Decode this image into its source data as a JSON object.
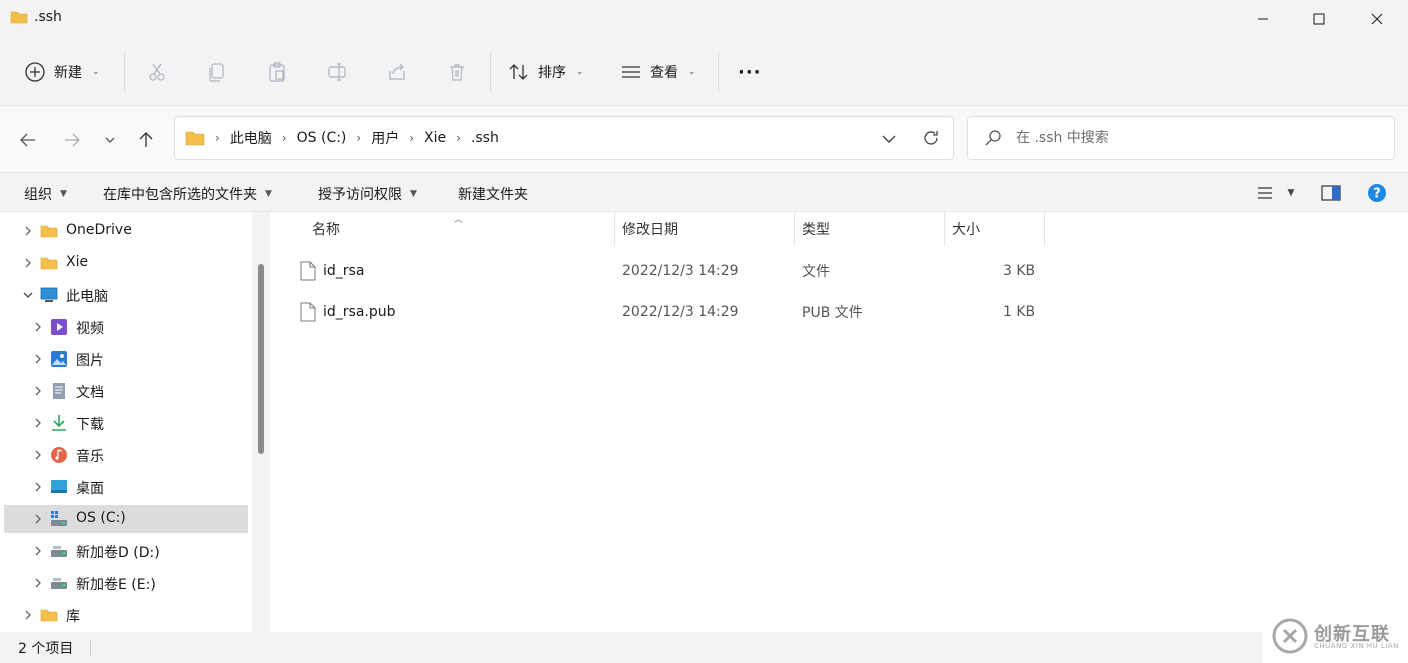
{
  "window": {
    "title": ".ssh"
  },
  "toolbar": {
    "new_label": "新建",
    "sort_label": "排序",
    "view_label": "查看",
    "more_label": "···"
  },
  "address": {
    "crumbs": [
      "此电脑",
      "OS (C:)",
      "用户",
      "Xie",
      ".ssh"
    ],
    "search_placeholder": "在 .ssh 中搜索"
  },
  "commands": {
    "organize": "组织",
    "include_in_library": "在库中包含所选的文件夹",
    "grant_access": "授予访问权限",
    "new_folder": "新建文件夹"
  },
  "nav": {
    "items": [
      {
        "label": "OneDrive",
        "icon": "folder-icon",
        "level": 0,
        "expanded": false
      },
      {
        "label": "Xie",
        "icon": "folder-icon",
        "level": 0,
        "expanded": false
      },
      {
        "label": "此电脑",
        "icon": "computer-icon",
        "level": 0,
        "expanded": true
      },
      {
        "label": "视频",
        "icon": "videos-icon",
        "level": 1,
        "expanded": false
      },
      {
        "label": "图片",
        "icon": "pictures-icon",
        "level": 1,
        "expanded": false
      },
      {
        "label": "文档",
        "icon": "documents-icon",
        "level": 1,
        "expanded": false
      },
      {
        "label": "下载",
        "icon": "downloads-icon",
        "level": 1,
        "expanded": false
      },
      {
        "label": "音乐",
        "icon": "music-icon",
        "level": 1,
        "expanded": false
      },
      {
        "label": "桌面",
        "icon": "desktop-icon",
        "level": 1,
        "expanded": false
      },
      {
        "label": "OS (C:)",
        "icon": "os-drive-icon",
        "level": 1,
        "expanded": false,
        "selected": true
      },
      {
        "label": "新加卷D (D:)",
        "icon": "drive-icon",
        "level": 1,
        "expanded": false
      },
      {
        "label": "新加卷E (E:)",
        "icon": "drive-icon",
        "level": 1,
        "expanded": false
      },
      {
        "label": "库",
        "icon": "folder-icon",
        "level": 0,
        "expanded": false
      }
    ]
  },
  "columns": {
    "name": "名称",
    "modified": "修改日期",
    "type": "类型",
    "size": "大小"
  },
  "files": [
    {
      "name": "id_rsa",
      "modified": "2022/12/3 14:29",
      "type": "文件",
      "size": "3 KB"
    },
    {
      "name": "id_rsa.pub",
      "modified": "2022/12/3 14:29",
      "type": "PUB 文件",
      "size": "1 KB"
    }
  ],
  "status": {
    "item_count": "2 个项目"
  },
  "watermark": {
    "text": "创新互联",
    "sub": "CHUANG XIN HU LIAN"
  },
  "colors": {
    "folder": "#f2c04a",
    "accent": "#0067c0",
    "selected_bg": "#dcdcdc"
  }
}
